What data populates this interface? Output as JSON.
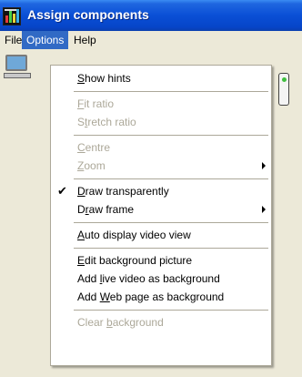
{
  "window": {
    "title": "Assign components"
  },
  "menubar": {
    "items": [
      "File",
      "Options",
      "Help"
    ]
  },
  "options_menu": {
    "show_hints": {
      "pre": "",
      "u": "S",
      "post": "how hints"
    },
    "fit_ratio": {
      "pre": "",
      "u": "F",
      "post": "it ratio"
    },
    "stretch_ratio": {
      "pre": "S",
      "u": "t",
      "post": "retch ratio"
    },
    "centre": {
      "pre": "",
      "u": "C",
      "post": "entre"
    },
    "zoom": {
      "pre": "",
      "u": "Z",
      "post": "oom"
    },
    "draw_transparently": {
      "pre": "",
      "u": "D",
      "post": "raw transparently",
      "check": "✔"
    },
    "draw_frame": {
      "pre": "D",
      "u": "r",
      "post": "aw frame"
    },
    "auto_display_video_view": {
      "pre": "",
      "u": "A",
      "post": "uto display video view"
    },
    "edit_background_picture": {
      "pre": "",
      "u": "E",
      "post": "dit background picture"
    },
    "add_live_video": {
      "pre": "Add ",
      "u": "l",
      "post": "ive video as background"
    },
    "add_web_page": {
      "pre": "Add ",
      "u": "W",
      "post": "eb page as background"
    },
    "clear_background": {
      "pre": "Clear ",
      "u": "b",
      "post": "ackground"
    }
  }
}
